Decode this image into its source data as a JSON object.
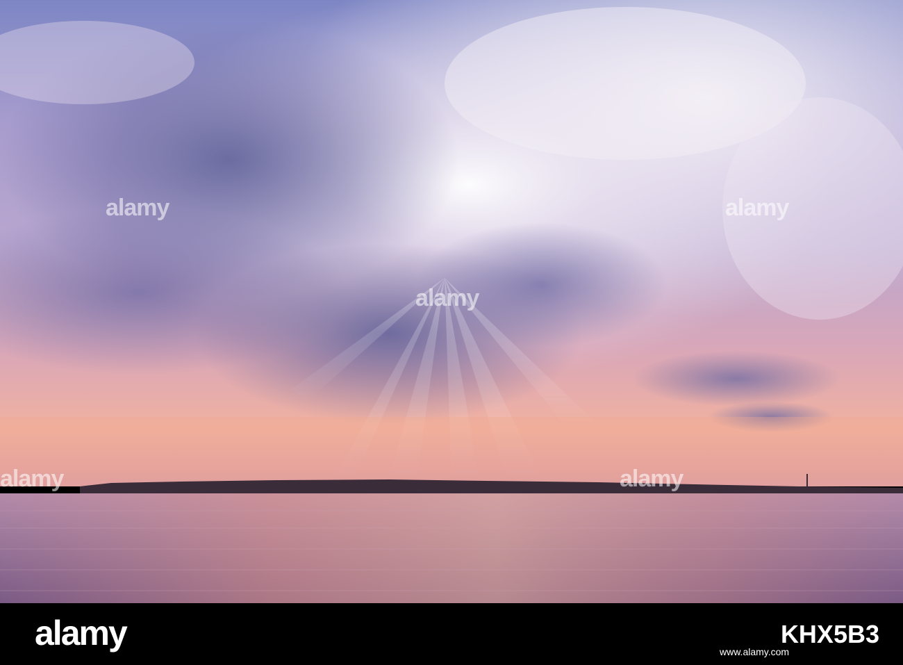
{
  "watermark": {
    "text": "alamy"
  },
  "footer": {
    "brand": "alamy",
    "url": "www.alamy.com",
    "image_id": "KHX5B3"
  },
  "colors": {
    "sky_top": "#6e7fb8",
    "sky_light": "#e9e4f0",
    "clouds_dark": "#6a6c9f",
    "horizon_glow": "#e6a39a",
    "water": "#8f6f99",
    "land": "#3b2c3a",
    "footer_bg": "#000000"
  }
}
